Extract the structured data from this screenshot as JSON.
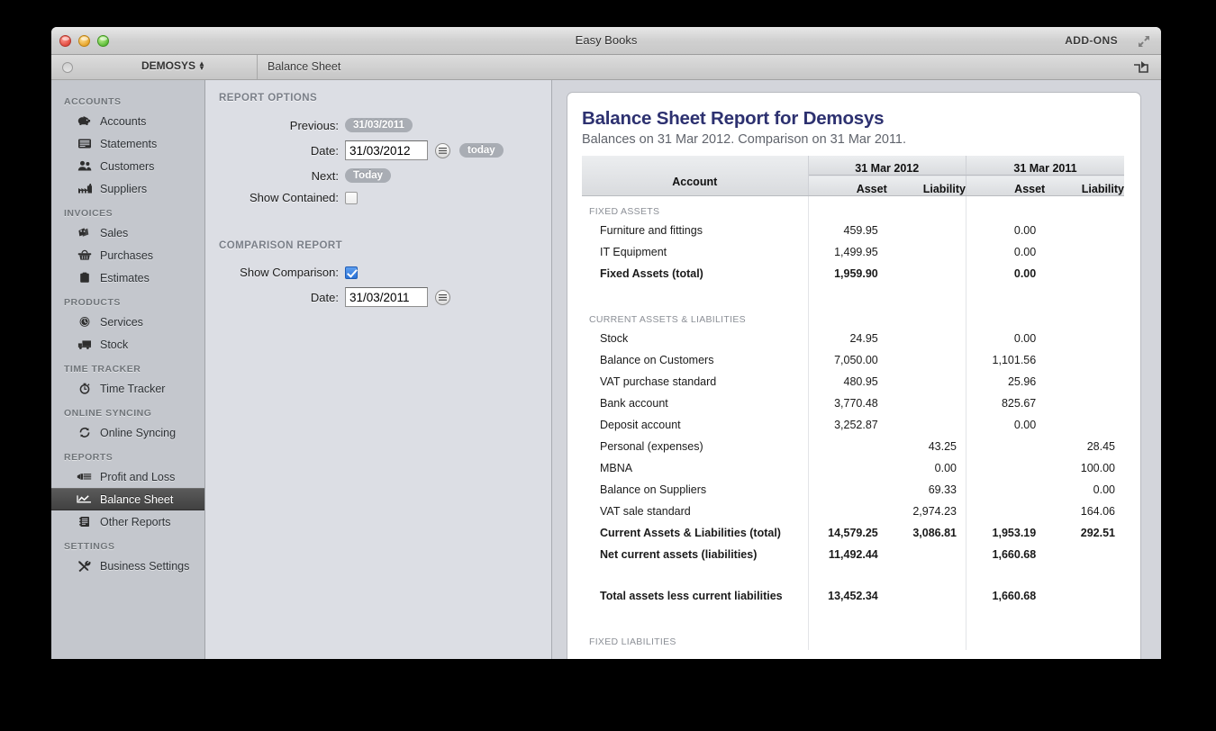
{
  "window": {
    "title": "Easy Books",
    "addons_label": "ADD-ONS",
    "toolbar": {
      "company": "DEMOSYS",
      "breadcrumb": "Balance Sheet"
    }
  },
  "sidebar": {
    "groups": [
      {
        "label": "ACCOUNTS",
        "items": [
          {
            "label": "Accounts",
            "icon": "piggy-bank-icon",
            "selected": false
          },
          {
            "label": "Statements",
            "icon": "statement-icon",
            "selected": false
          },
          {
            "label": "Customers",
            "icon": "customers-icon",
            "selected": false
          },
          {
            "label": "Suppliers",
            "icon": "suppliers-icon",
            "selected": false
          }
        ]
      },
      {
        "label": "INVOICES",
        "items": [
          {
            "label": "Sales",
            "icon": "tag-icon",
            "selected": false
          },
          {
            "label": "Purchases",
            "icon": "basket-icon",
            "selected": false
          },
          {
            "label": "Estimates",
            "icon": "clipboard-icon",
            "selected": false
          }
        ]
      },
      {
        "label": "PRODUCTS",
        "items": [
          {
            "label": "Services",
            "icon": "clock-icon",
            "selected": false
          },
          {
            "label": "Stock",
            "icon": "truck-icon",
            "selected": false
          }
        ]
      },
      {
        "label": "TIME TRACKER",
        "items": [
          {
            "label": "Time Tracker",
            "icon": "stopwatch-icon",
            "selected": false
          }
        ]
      },
      {
        "label": "ONLINE SYNCING",
        "items": [
          {
            "label": "Online Syncing",
            "icon": "sync-icon",
            "selected": false
          }
        ]
      },
      {
        "label": "REPORTS",
        "items": [
          {
            "label": "Profit and Loss",
            "icon": "bar-report-icon",
            "selected": false
          },
          {
            "label": "Balance Sheet",
            "icon": "line-chart-icon",
            "selected": true
          },
          {
            "label": "Other Reports",
            "icon": "book-icon",
            "selected": false
          }
        ]
      },
      {
        "label": "SETTINGS",
        "items": [
          {
            "label": "Business Settings",
            "icon": "tools-icon",
            "selected": false
          }
        ]
      }
    ]
  },
  "options": {
    "report_options_heading": "REPORT OPTIONS",
    "previous_label": "Previous:",
    "previous_value": "31/03/2011",
    "date_label": "Date:",
    "date_value": "31/03/2012",
    "today_pill": "today",
    "next_label": "Next:",
    "next_value": "Today",
    "show_contained_label": "Show Contained:",
    "show_contained_checked": false,
    "comparison_heading": "COMPARISON REPORT",
    "show_comparison_label": "Show Comparison:",
    "show_comparison_checked": true,
    "comparison_date_label": "Date:",
    "comparison_date_value": "31/03/2011"
  },
  "report": {
    "title": "Balance Sheet Report for Demosys",
    "subtitle": "Balances on 31 Mar 2012. Comparison on 31 Mar 2011.",
    "columns": {
      "account": "Account",
      "period_1": "31 Mar 2012",
      "period_2": "31 Mar 2011",
      "asset": "Asset",
      "liability": "Liability"
    },
    "rows": [
      {
        "type": "section",
        "label": "FIXED ASSETS"
      },
      {
        "type": "row",
        "label": "Furniture and fittings",
        "a1": "459.95",
        "l1": "",
        "a2": "0.00",
        "l2": ""
      },
      {
        "type": "row",
        "label": "IT Equipment",
        "a1": "1,499.95",
        "l1": "",
        "a2": "0.00",
        "l2": ""
      },
      {
        "type": "bold",
        "label": "Fixed Assets (total)",
        "a1": "1,959.90",
        "l1": "",
        "a2": "0.00",
        "l2": ""
      },
      {
        "type": "spacer"
      },
      {
        "type": "section",
        "label": "CURRENT ASSETS & LIABILITIES"
      },
      {
        "type": "row",
        "label": "Stock",
        "a1": "24.95",
        "l1": "",
        "a2": "0.00",
        "l2": ""
      },
      {
        "type": "row",
        "label": "Balance on Customers",
        "a1": "7,050.00",
        "l1": "",
        "a2": "1,101.56",
        "l2": ""
      },
      {
        "type": "row",
        "label": "VAT purchase standard",
        "a1": "480.95",
        "l1": "",
        "a2": "25.96",
        "l2": ""
      },
      {
        "type": "row",
        "label": "Bank account",
        "a1": "3,770.48",
        "l1": "",
        "a2": "825.67",
        "l2": ""
      },
      {
        "type": "row",
        "label": "Deposit account",
        "a1": "3,252.87",
        "l1": "",
        "a2": "0.00",
        "l2": ""
      },
      {
        "type": "row",
        "label": "Personal (expenses)",
        "a1": "",
        "l1": "43.25",
        "a2": "",
        "l2": "28.45"
      },
      {
        "type": "row",
        "label": "MBNA",
        "a1": "",
        "l1": "0.00",
        "a2": "",
        "l2": "100.00"
      },
      {
        "type": "row",
        "label": "Balance on Suppliers",
        "a1": "",
        "l1": "69.33",
        "a2": "",
        "l2": "0.00"
      },
      {
        "type": "row",
        "label": "VAT sale standard",
        "a1": "",
        "l1": "2,974.23",
        "a2": "",
        "l2": "164.06"
      },
      {
        "type": "bold",
        "label": "Current Assets & Liabilities (total)",
        "a1": "14,579.25",
        "l1": "3,086.81",
        "a2": "1,953.19",
        "l2": "292.51"
      },
      {
        "type": "bold",
        "label": "Net current assets (liabilities)",
        "a1": "11,492.44",
        "l1": "",
        "a2": "1,660.68",
        "l2": ""
      },
      {
        "type": "spacer"
      },
      {
        "type": "bold",
        "label": "Total assets less current liabilities",
        "a1": "13,452.34",
        "l1": "",
        "a2": "1,660.68",
        "l2": ""
      },
      {
        "type": "spacer"
      },
      {
        "type": "section",
        "label": "FIXED LIABILITIES"
      }
    ]
  },
  "colors": {
    "report_title": "#2d3170",
    "sidebar_bg": "#c4c7cd",
    "selection": "#4a4a4a",
    "checkbox_accent": "#2a72d6"
  }
}
